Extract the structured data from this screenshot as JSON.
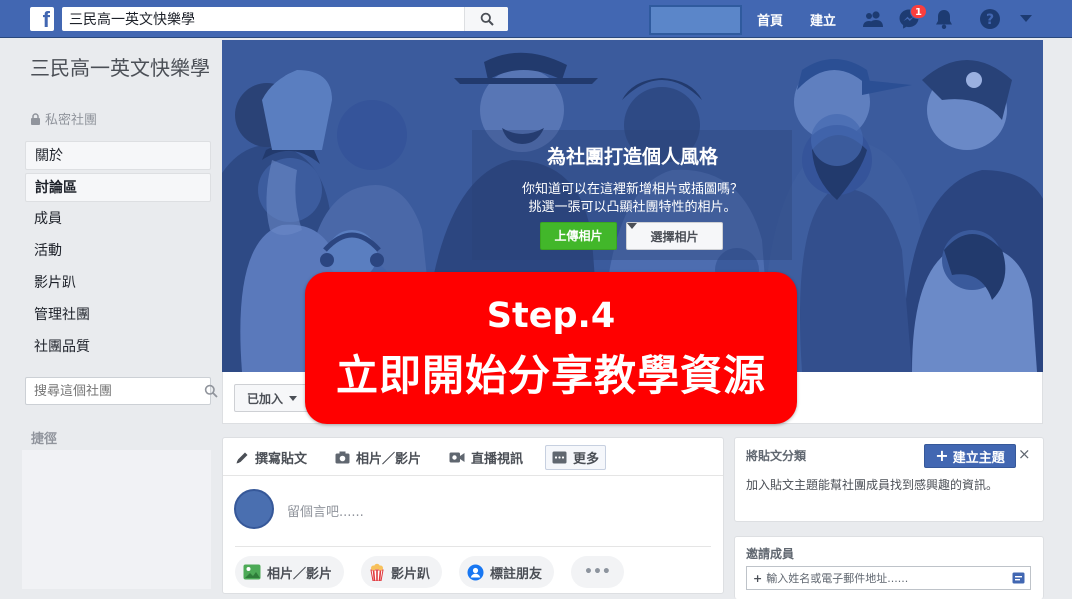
{
  "topbar": {
    "logo": "f",
    "search_value": "三民高一英文快樂學",
    "home_label": "首頁",
    "create_label": "建立",
    "notification_count": "1",
    "icons": [
      "friends-icon",
      "messenger-icon",
      "notifications-icon",
      "help-icon",
      "dropdown-caret-icon"
    ]
  },
  "sidebar": {
    "group_name": "三民高一英文快樂學",
    "privacy": "私密社團",
    "items": [
      {
        "label": "關於"
      },
      {
        "label": "討論區"
      },
      {
        "label": "成員"
      },
      {
        "label": "活動"
      },
      {
        "label": "影片趴"
      },
      {
        "label": "管理社團"
      },
      {
        "label": "社團品質"
      }
    ],
    "search_placeholder": "搜尋這個社團",
    "shortcuts_label": "捷徑"
  },
  "cover": {
    "title": "為社團打造個人風格",
    "line1": "你知道可以在這裡新增相片或插圖嗎？",
    "line2": "挑選一張可以凸顯社團特性的相片。",
    "upload_label": "上傳相片",
    "choose_label": "選擇相片"
  },
  "joined_label": "已加入",
  "overlay": {
    "line1": "Step.4",
    "line2": "立即開始分享教學資源"
  },
  "composer": {
    "tabs": [
      {
        "label": "撰寫貼文",
        "icon": "pencil-icon"
      },
      {
        "label": "相片／影片",
        "icon": "camera-icon"
      },
      {
        "label": "直播視訊",
        "icon": "video-camera-icon"
      },
      {
        "label": "更多",
        "icon": "more-icon"
      }
    ],
    "placeholder": "留個言吧......",
    "pills": [
      {
        "label": "相片／影片",
        "icon": "photo-icon"
      },
      {
        "label": "影片趴",
        "icon": "popcorn-icon"
      },
      {
        "label": "標註朋友",
        "icon": "tag-friend-icon"
      },
      {
        "label": "•••",
        "icon": "ellipsis-icon"
      }
    ]
  },
  "topics_card": {
    "title": "將貼文分類",
    "create_label": "建立主題",
    "close": "×",
    "body": "加入貼文主題能幫社團成員找到感興趣的資訊。"
  },
  "invite_card": {
    "title": "邀請成員",
    "placeholder": "輸入姓名或電子郵件地址......"
  },
  "colors": {
    "topbar": "#4267b2",
    "overlay": "#ff0000",
    "upload_green": "#42b72a",
    "cover_bg": "#3a5a9c"
  }
}
